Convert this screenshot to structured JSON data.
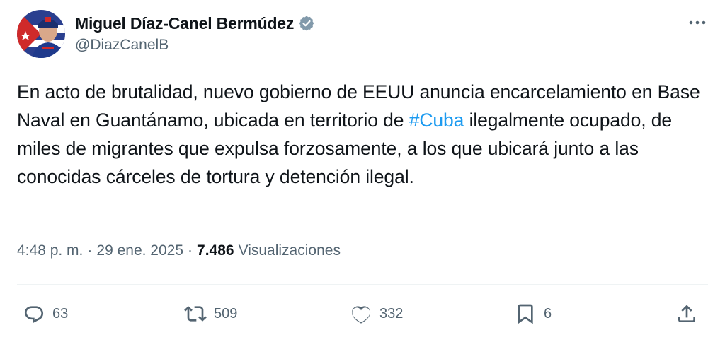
{
  "author": {
    "display_name": "Miguel Díaz-Canel Bermúdez",
    "handle": "@DiazCanelB",
    "verified": true
  },
  "tweet": {
    "text_before": "En acto de brutalidad, nuevo gobierno de EEUU anuncia encarcelamiento en Base Naval en Guantánamo, ubicada en territorio de ",
    "hashtag": "#Cuba",
    "text_after": " ilegalmente ocupado, de miles de migrantes que expulsa forzosamente, a los que ubicará junto a las conocidas cárceles de tortura y detención ilegal."
  },
  "meta": {
    "time": "4:48 p. m.",
    "separator": "·",
    "date": "29 ene. 2025",
    "views_count": "7.486",
    "views_label": "Visualizaciones"
  },
  "actions": {
    "replies": "63",
    "reposts": "509",
    "likes": "332",
    "bookmarks": "6"
  },
  "icons": {
    "more": "more-horizontal-icon",
    "verified": "verified-badge-icon",
    "reply": "reply-icon",
    "repost": "repost-icon",
    "like": "heart-icon",
    "bookmark": "bookmark-icon",
    "share": "share-icon"
  },
  "colors": {
    "text": "#0f1419",
    "secondary": "#536471",
    "link": "#1d9bf0",
    "divider": "#eff3f4",
    "verified_badge": "#829aab"
  }
}
